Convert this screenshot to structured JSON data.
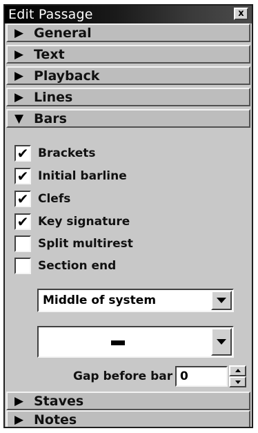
{
  "window": {
    "title": "Edit Passage",
    "close_glyph": "x"
  },
  "sections_top": [
    {
      "label": "General",
      "arrow": "▶"
    },
    {
      "label": "Text",
      "arrow": "▶"
    },
    {
      "label": "Playback",
      "arrow": "▶"
    },
    {
      "label": "Lines",
      "arrow": "▶"
    },
    {
      "label": "Bars",
      "arrow": "▼",
      "expanded": true
    }
  ],
  "bars": {
    "checkboxes": [
      {
        "label": "Brackets",
        "checked": true
      },
      {
        "label": "Initial barline",
        "checked": true
      },
      {
        "label": "Clefs",
        "checked": true
      },
      {
        "label": "Key signature",
        "checked": true
      },
      {
        "label": "Split multirest",
        "checked": false
      },
      {
        "label": "Section end",
        "checked": false
      }
    ],
    "position_select": {
      "value": "Middle of system"
    },
    "barline_select": {
      "value_icon": "single-barline-dash"
    },
    "gap_before_bar": {
      "label": "Gap before bar",
      "value": "0"
    }
  },
  "sections_bottom": [
    {
      "label": "Staves",
      "arrow": "▶"
    },
    {
      "label": "Notes",
      "arrow": "▶"
    }
  ],
  "colors": {
    "panel_bg": "#c8c8c8",
    "title_bar_start": "#000000",
    "title_bar_end": "#4c4c4c",
    "text": "#111111"
  }
}
